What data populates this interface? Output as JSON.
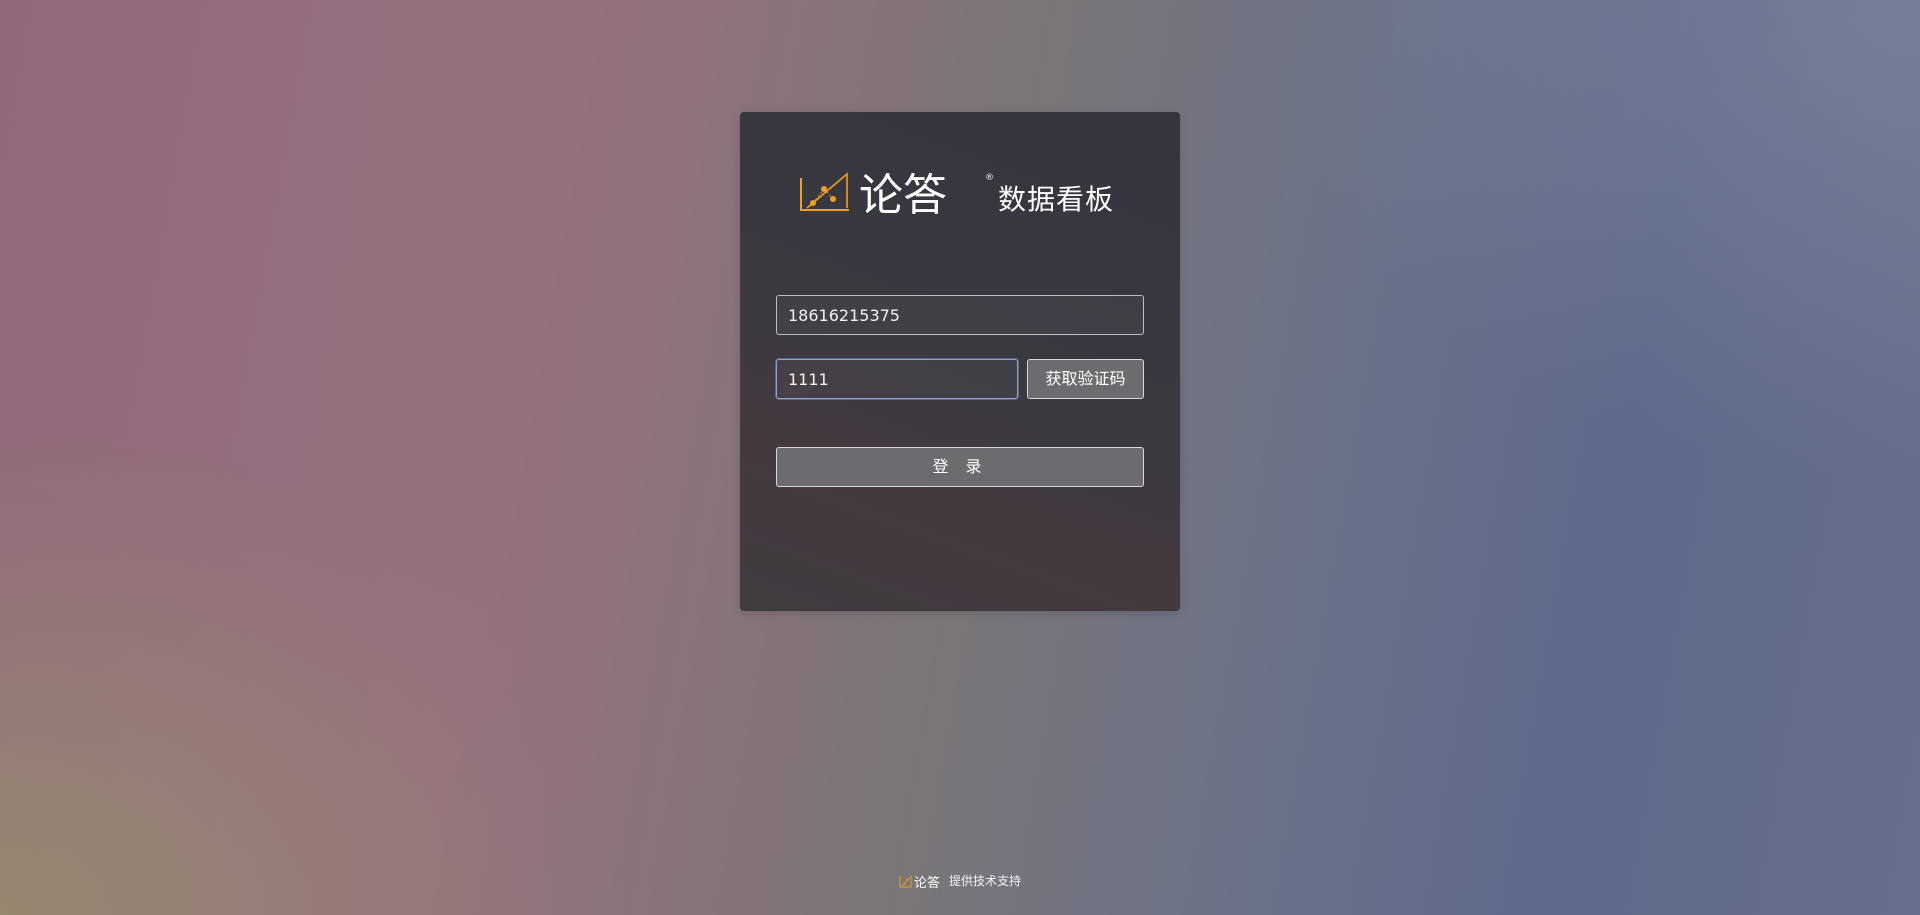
{
  "logo": {
    "brand_text": "论答",
    "registered_mark": "®",
    "title": "数据看板"
  },
  "form": {
    "phone": {
      "value": "18616215375"
    },
    "code": {
      "value": "1111"
    },
    "get_code_label": "获取验证码",
    "login_label": "登 录"
  },
  "footer": {
    "text": "提供技术支持"
  },
  "colors": {
    "accent": "#f0a020",
    "text": "#ffffff"
  }
}
